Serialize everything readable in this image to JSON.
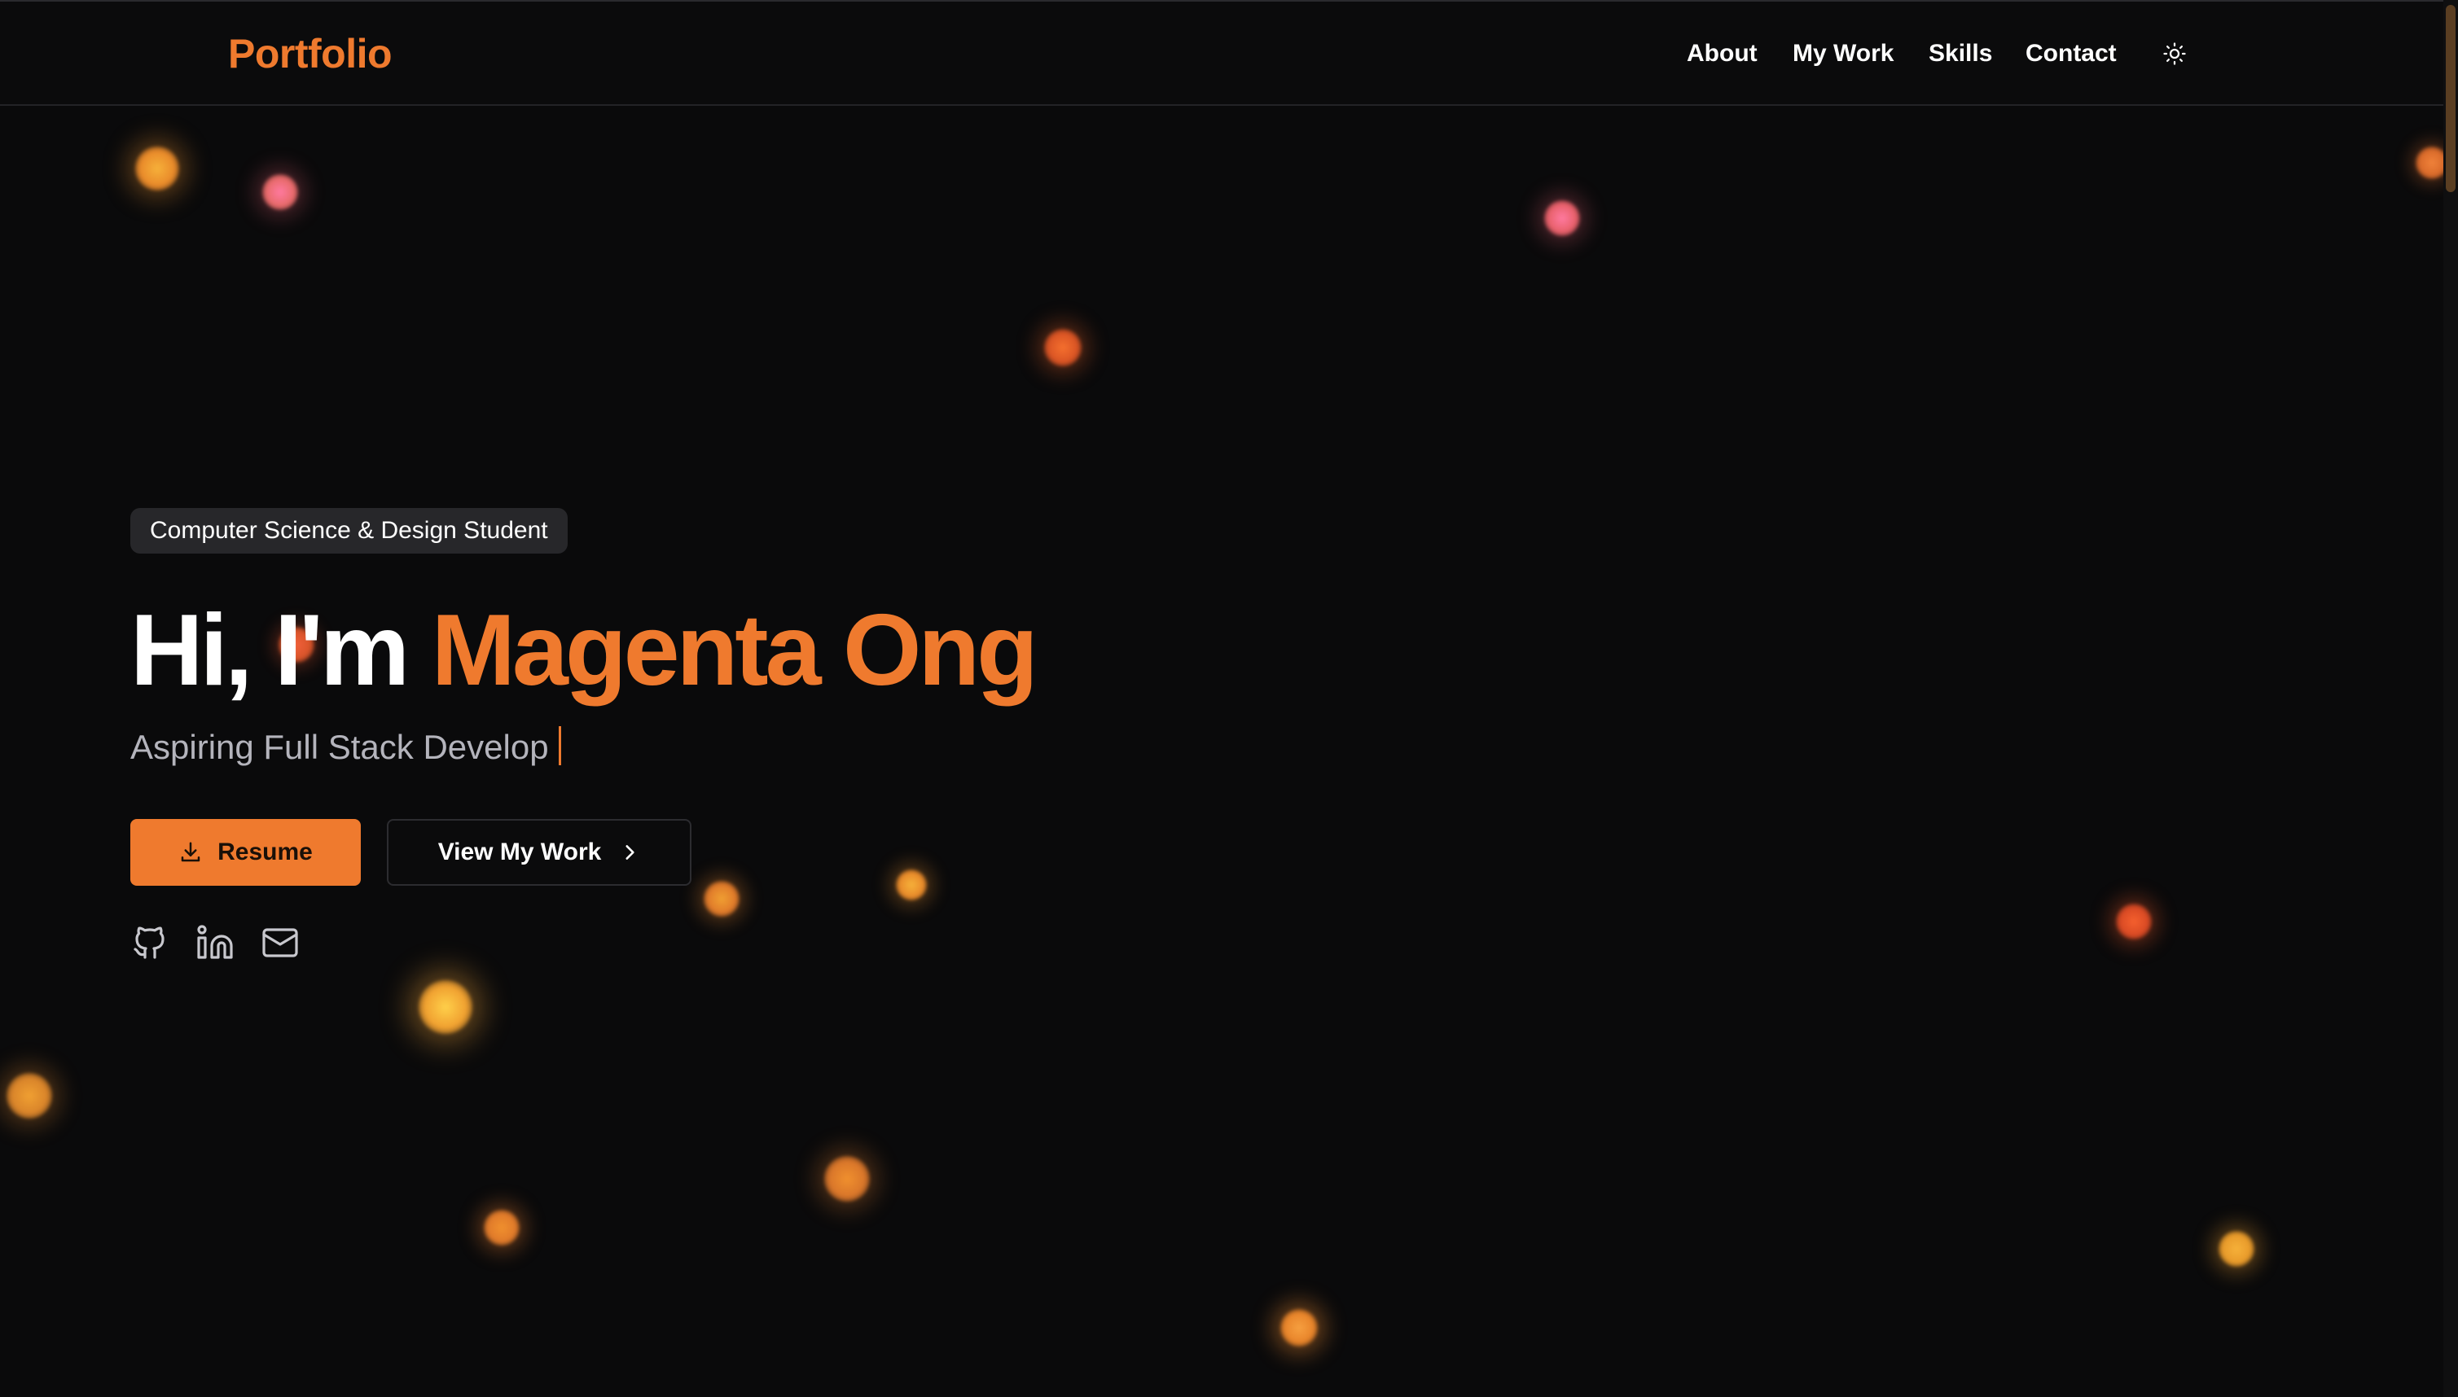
{
  "header": {
    "logo": "Portfolio",
    "nav": [
      {
        "label": "About"
      },
      {
        "label": "My Work"
      },
      {
        "label": "Skills"
      },
      {
        "label": "Contact"
      }
    ],
    "theme_toggle_icon": "sun-icon"
  },
  "hero": {
    "badge": "Computer Science & Design Student",
    "greeting": "Hi, I'm",
    "name": "Magenta Ong",
    "subtitle": "Aspiring Full Stack Develop",
    "buttons": {
      "resume": {
        "label": "Resume",
        "icon": "download-icon"
      },
      "work": {
        "label": "View My Work",
        "icon": "chevron-right-icon"
      }
    },
    "socials": [
      {
        "icon": "github-icon"
      },
      {
        "icon": "linkedin-icon"
      },
      {
        "icon": "mail-icon"
      }
    ]
  },
  "colors": {
    "background": "#0a0a0b",
    "accent": "#ef7a2e",
    "badge_bg": "#27272a",
    "muted_text": "#b4b4bc"
  }
}
